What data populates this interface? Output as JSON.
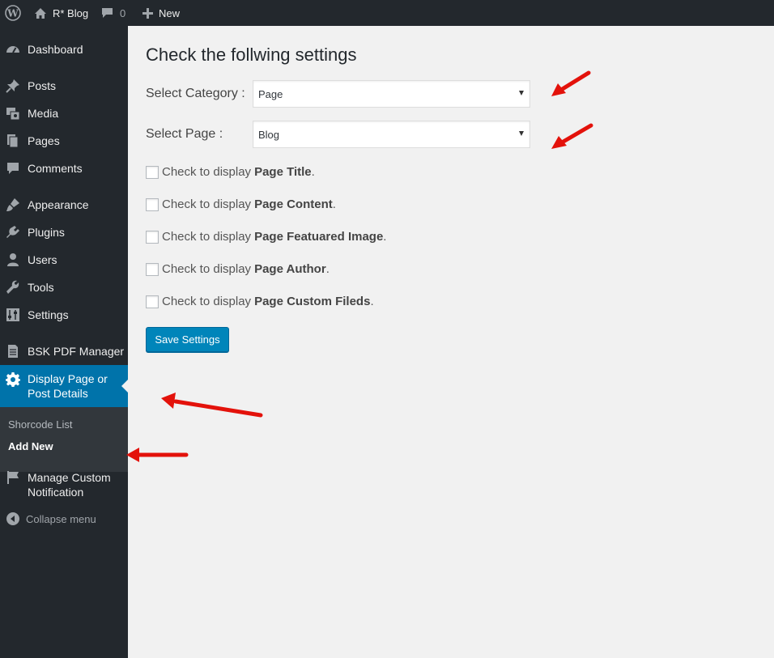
{
  "admin_bar": {
    "site_name": "R* Blog",
    "comments_count": "0",
    "new_label": "New"
  },
  "sidebar": {
    "items": [
      {
        "label": "Dashboard",
        "icon": "dashboard-icon"
      },
      {
        "label": "Posts",
        "icon": "pin-icon"
      },
      {
        "label": "Media",
        "icon": "media-icon"
      },
      {
        "label": "Pages",
        "icon": "pages-icon"
      },
      {
        "label": "Comments",
        "icon": "comment-icon"
      },
      {
        "label": "Appearance",
        "icon": "brush-icon"
      },
      {
        "label": "Plugins",
        "icon": "plug-icon"
      },
      {
        "label": "Users",
        "icon": "user-icon"
      },
      {
        "label": "Tools",
        "icon": "wrench-icon"
      },
      {
        "label": "Settings",
        "icon": "settings-icon"
      },
      {
        "label": "BSK PDF Manager",
        "icon": "document-icon"
      },
      {
        "label_line1": "Display Page or",
        "label_line2": "Post Details",
        "icon": "gear-icon"
      },
      {
        "label_line1": "Manage Custom",
        "label_line2": "Notification",
        "icon": "flag-icon"
      }
    ],
    "submenu": [
      "Shorcode List",
      "Add New"
    ],
    "collapse_label": "Collapse menu"
  },
  "main": {
    "heading": "Check the follwing settings",
    "category_label": "Select Category :",
    "category_value": "Page",
    "page_label": "Select Page :",
    "page_value": "Blog",
    "checks": [
      {
        "prefix": "Check to display",
        "bold": "Page Title",
        "suffix": "."
      },
      {
        "prefix": "Check to display",
        "bold": "Page Content",
        "suffix": "."
      },
      {
        "prefix": "Check to display",
        "bold": "Page Featuared Image",
        "suffix": "."
      },
      {
        "prefix": "Check to display",
        "bold": "Page Author",
        "suffix": "."
      },
      {
        "prefix": "Check to display",
        "bold": "Page Custom Fileds",
        "suffix": "."
      }
    ],
    "save_label": "Save Settings"
  },
  "colors": {
    "admin_bar": "#23282d",
    "current_menu": "#0073aa",
    "button": "#0085ba",
    "annotation_arrow": "#e3120b"
  }
}
